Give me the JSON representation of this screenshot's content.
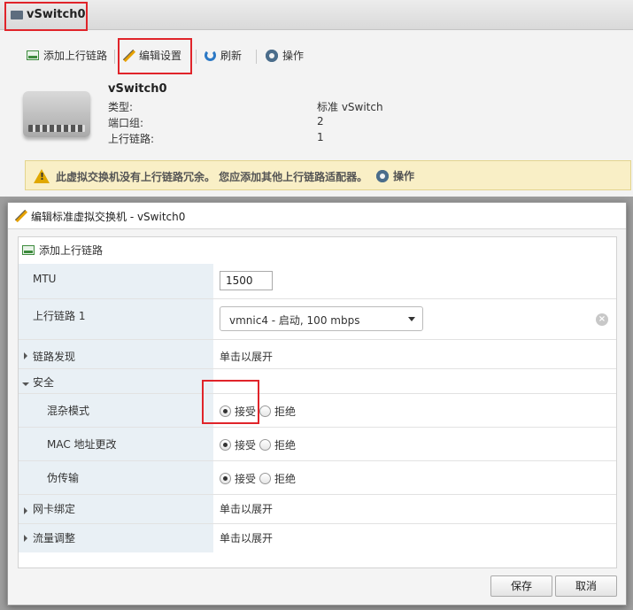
{
  "app": {
    "title": "vSwitch0"
  },
  "toolbar": {
    "add_uplink": "添加上行链路",
    "edit_settings": "编辑设置",
    "refresh": "刷新",
    "actions": "操作"
  },
  "summary": {
    "name": "vSwitch0",
    "rows": [
      {
        "label": "类型:",
        "value": "标准 vSwitch"
      },
      {
        "label": "端口组:",
        "value": "2"
      },
      {
        "label": "上行链路:",
        "value": "1"
      }
    ]
  },
  "warning": {
    "text": "此虚拟交换机没有上行链路冗余。 您应添加其他上行链路适配器。",
    "action": "操作"
  },
  "dialog": {
    "title": "编辑标准虚拟交换机 - vSwitch0",
    "add_uplink": "添加上行链路",
    "mtu": {
      "label": "MTU",
      "value": "1500"
    },
    "uplink1": {
      "label": "上行链路 1",
      "value": "vmnic4 - 启动, 100 mbps",
      "clear": "×"
    },
    "link_discovery": {
      "label": "链路发现",
      "value": "单击以展开"
    },
    "security": {
      "label": "安全",
      "promiscuous": {
        "label": "混杂模式",
        "accept": "接受",
        "reject": "拒绝",
        "selected": "accept"
      },
      "mac_change": {
        "label": "MAC 地址更改",
        "accept": "接受",
        "reject": "拒绝",
        "selected": "accept"
      },
      "forged": {
        "label": "伪传输",
        "accept": "接受",
        "reject": "拒绝",
        "selected": "accept"
      }
    },
    "nic_teaming": {
      "label": "网卡绑定",
      "value": "单击以展开"
    },
    "traffic_shaping": {
      "label": "流量调整",
      "value": "单击以展开"
    },
    "buttons": {
      "save": "保存",
      "cancel": "取消"
    }
  },
  "colors": {
    "highlight": "#e0242a",
    "label_bg": "#e9f0f5",
    "warning_bg": "#f9efc6"
  }
}
